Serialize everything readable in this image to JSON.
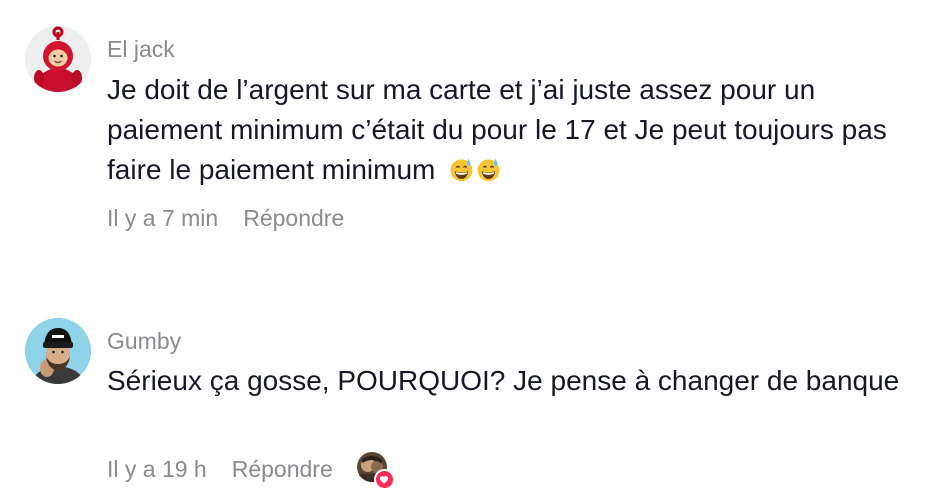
{
  "comments": [
    {
      "username": "El jack",
      "text": "Je doit de l’argent sur ma carte et j’ai juste assez pour un paiement minimum c’était du pour le 17 et Je peut toujours pas faire le paiement minimum",
      "emojis": [
        "grinning-sweat-emoji",
        "grinning-sweat-emoji"
      ],
      "time": "Il y a 7 min",
      "reply_label": "Répondre"
    },
    {
      "username": "Gumby",
      "text": "Sérieux ça gosse, POURQUOI? Je pense à changer de banque",
      "time": "Il y a 19 h",
      "reply_label": "Répondre",
      "creator_liked": true
    }
  ],
  "colors": {
    "text": "#161823",
    "muted": "#8a8a8f",
    "heart": "#fe2c55"
  }
}
